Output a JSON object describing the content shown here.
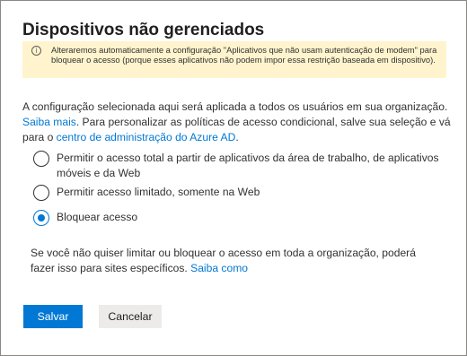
{
  "dialog": {
    "title": "Dispositivos não gerenciados"
  },
  "banner": {
    "icon": "info-icon",
    "icon_glyph": "i",
    "background": "#fff4ce",
    "text": "Alteraremos automaticamente a configuração \"Aplicativos que não usam autenticação de modem\" para bloquear o acesso (porque esses aplicativos não podem impor essa restrição baseada em dispositivo)."
  },
  "description": {
    "text_1": "A configuração selecionada aqui será aplicada a todos os usuários em sua organização. ",
    "link_1": "Saiba mais",
    "text_2": ". Para personalizar as políticas de acesso condicional, salve sua seleção e vá para o ",
    "link_2": "centro de administração do Azure AD",
    "text_3": "."
  },
  "options": [
    {
      "label": "Permitir o acesso total a partir de aplicativos da área de trabalho, de aplicativos móveis e da Web",
      "checked": false
    },
    {
      "label": "Permitir acesso limitado, somente na Web",
      "checked": false
    },
    {
      "label": "Bloquear acesso",
      "checked": true
    }
  ],
  "note": {
    "text": "Se você não quiser limitar ou bloquear o acesso em toda a organização, poderá fazer isso para sites específicos. ",
    "link": "Saiba como"
  },
  "buttons": {
    "save_label": "Salvar",
    "cancel_label": "Cancelar"
  },
  "colors": {
    "accent": "#0078d4",
    "banner": "#fff4ce",
    "secondary_button": "#edebe9"
  }
}
